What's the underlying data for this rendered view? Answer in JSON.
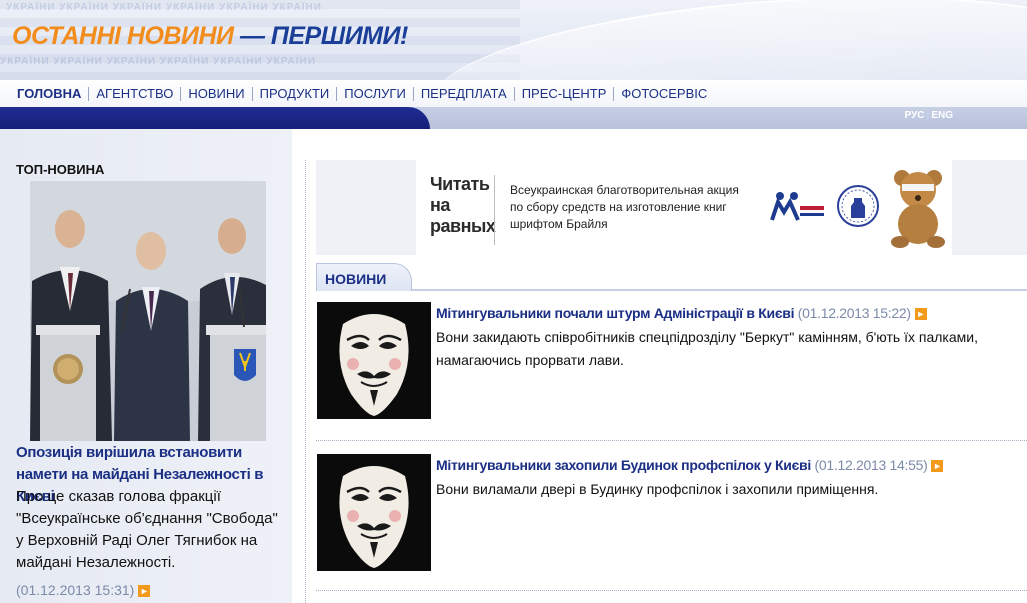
{
  "header": {
    "slogan_part1": "ОСТАННІ НОВИНИ",
    "slogan_part2": "— ПЕРШИМИ!",
    "colors": {
      "orange": "#f28c1c",
      "blue": "#1b3f98"
    }
  },
  "nav": {
    "items": [
      {
        "label": "ГОЛОВНА",
        "active": true
      },
      {
        "label": "АГЕНТСТВО",
        "active": false
      },
      {
        "label": "НОВИНИ",
        "active": false
      },
      {
        "label": "ПРОДУКТИ",
        "active": false
      },
      {
        "label": "ПОСЛУГИ",
        "active": false
      },
      {
        "label": "ПЕРЕДПЛАТА",
        "active": false
      },
      {
        "label": "ПРЕС-ЦЕНТР",
        "active": false
      },
      {
        "label": "ФОТОСЕРВІС",
        "active": false
      }
    ]
  },
  "lang": {
    "rus": "РУС",
    "eng": "ENG"
  },
  "top_news": {
    "section_label": "ТОП-НОВИНА",
    "headline": "Опозиція вирішила встановити намети на майдані Незалежності в Києві",
    "summary": "Про це сказав голова фракції \"Всеукраїнське об'єднання \"Свобода\" у Верховній Раді Олег Тягнибок на майдані Незалежності.",
    "date": "(01.12.2013 15:31)"
  },
  "banner": {
    "logo_line1": "Читать",
    "logo_line2": "на",
    "logo_line3": "равных",
    "text": "Всеукраинская благотворительная акция по сбору средств на изготовление книг шрифтом Брайля"
  },
  "news": {
    "section_label": "НОВИНИ",
    "items": [
      {
        "title": "Мітингувальники почали штурм Адміністрації в Києві",
        "date": "(01.12.2013 15:22)",
        "text": "Вони закидають співробітників спецпідрозділу \"Беркут\" камінням, б'ють їх палками, намагаючись прорвати лави."
      },
      {
        "title": "Мітингувальники захопили Будинок профспілок у Києві",
        "date": "(01.12.2013 14:55)",
        "text": "Вони виламали двері в Будинку профспілок і захопили приміщення."
      }
    ]
  },
  "colors": {
    "nav_text": "#1b2f85",
    "link": "#1b2f85",
    "date": "#7c8aa9",
    "arrow": "#f39a1c",
    "strip_dark": "#1f2c92"
  }
}
